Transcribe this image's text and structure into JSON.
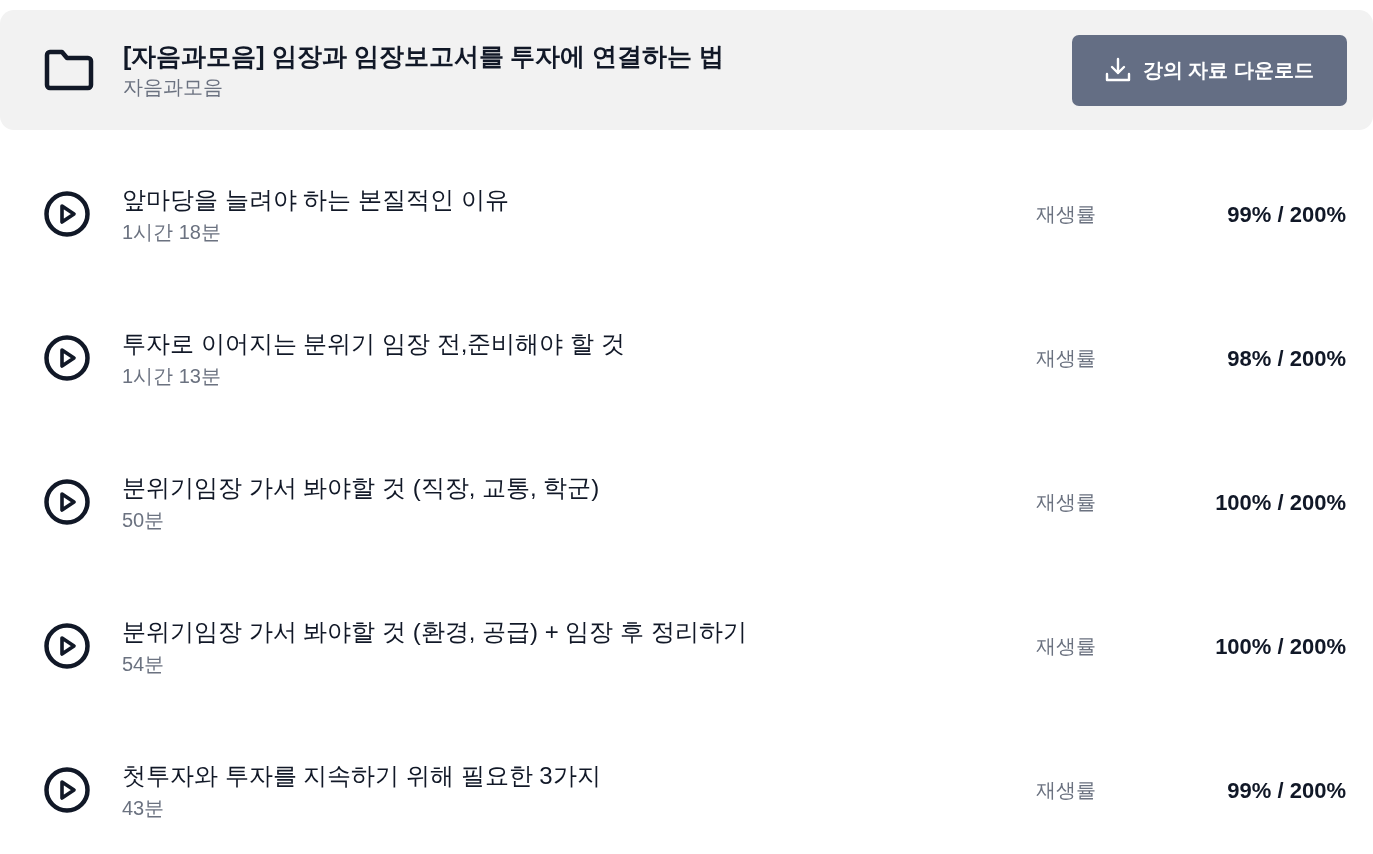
{
  "course": {
    "title": "[자음과모음] 임장과 임장보고서를 투자에 연결하는 법",
    "subtitle": "자음과모음",
    "download_button": {
      "label": "강의 자료 다운로드"
    }
  },
  "lessons": [
    {
      "title": "앞마당을 늘려야 하는 본질적인 이유",
      "duration": "1시간 18분",
      "progress_label": "재생률",
      "progress": "99% / 200%"
    },
    {
      "title": "투자로 이어지는 분위기 임장 전,준비해야 할 것",
      "duration": "1시간 13분",
      "progress_label": "재생률",
      "progress": "98% / 200%"
    },
    {
      "title": "분위기임장 가서 봐야할 것 (직장, 교통, 학군)",
      "duration": "50분",
      "progress_label": "재생률",
      "progress": "100% / 200%"
    },
    {
      "title": "분위기임장 가서 봐야할 것 (환경, 공급) + 임장 후 정리하기",
      "duration": "54분",
      "progress_label": "재생률",
      "progress": "100% / 200%"
    },
    {
      "title": "첫투자와 투자를 지속하기 위해 필요한 3가지",
      "duration": "43분",
      "progress_label": "재생률",
      "progress": "99% / 200%"
    }
  ]
}
